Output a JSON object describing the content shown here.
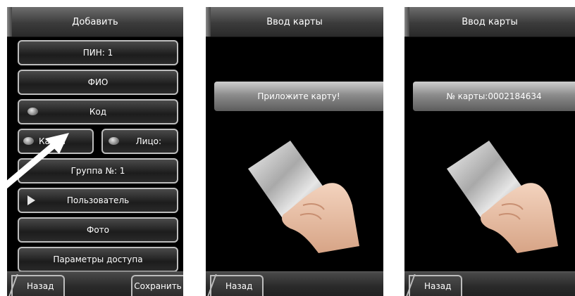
{
  "screens": [
    {
      "title": "Добавить",
      "buttons": {
        "pin": "ПИН: 1",
        "fio": "ФИО",
        "code": "Код",
        "card": "Карта",
        "face": "Лицо:",
        "group": "Группа №: 1",
        "user": "Пользователь",
        "photo": "Фото",
        "access": "Параметры доступа"
      },
      "back_label": "Назад",
      "save_label": "Сохранить"
    },
    {
      "title": "Ввод карты",
      "message": "Приложите карту!",
      "back_label": "Назад"
    },
    {
      "title": "Ввод карты",
      "message": "№ карты:0002184634",
      "back_label": "Назад"
    }
  ],
  "colors": {
    "screen_bg": "#000000",
    "button_border": "#bdbdbd",
    "arrow": "#ffffff"
  },
  "icons": [
    "indicator-led-icon",
    "play-triangle-icon",
    "hand-holding-card-icon",
    "pointer-arrow-icon"
  ]
}
